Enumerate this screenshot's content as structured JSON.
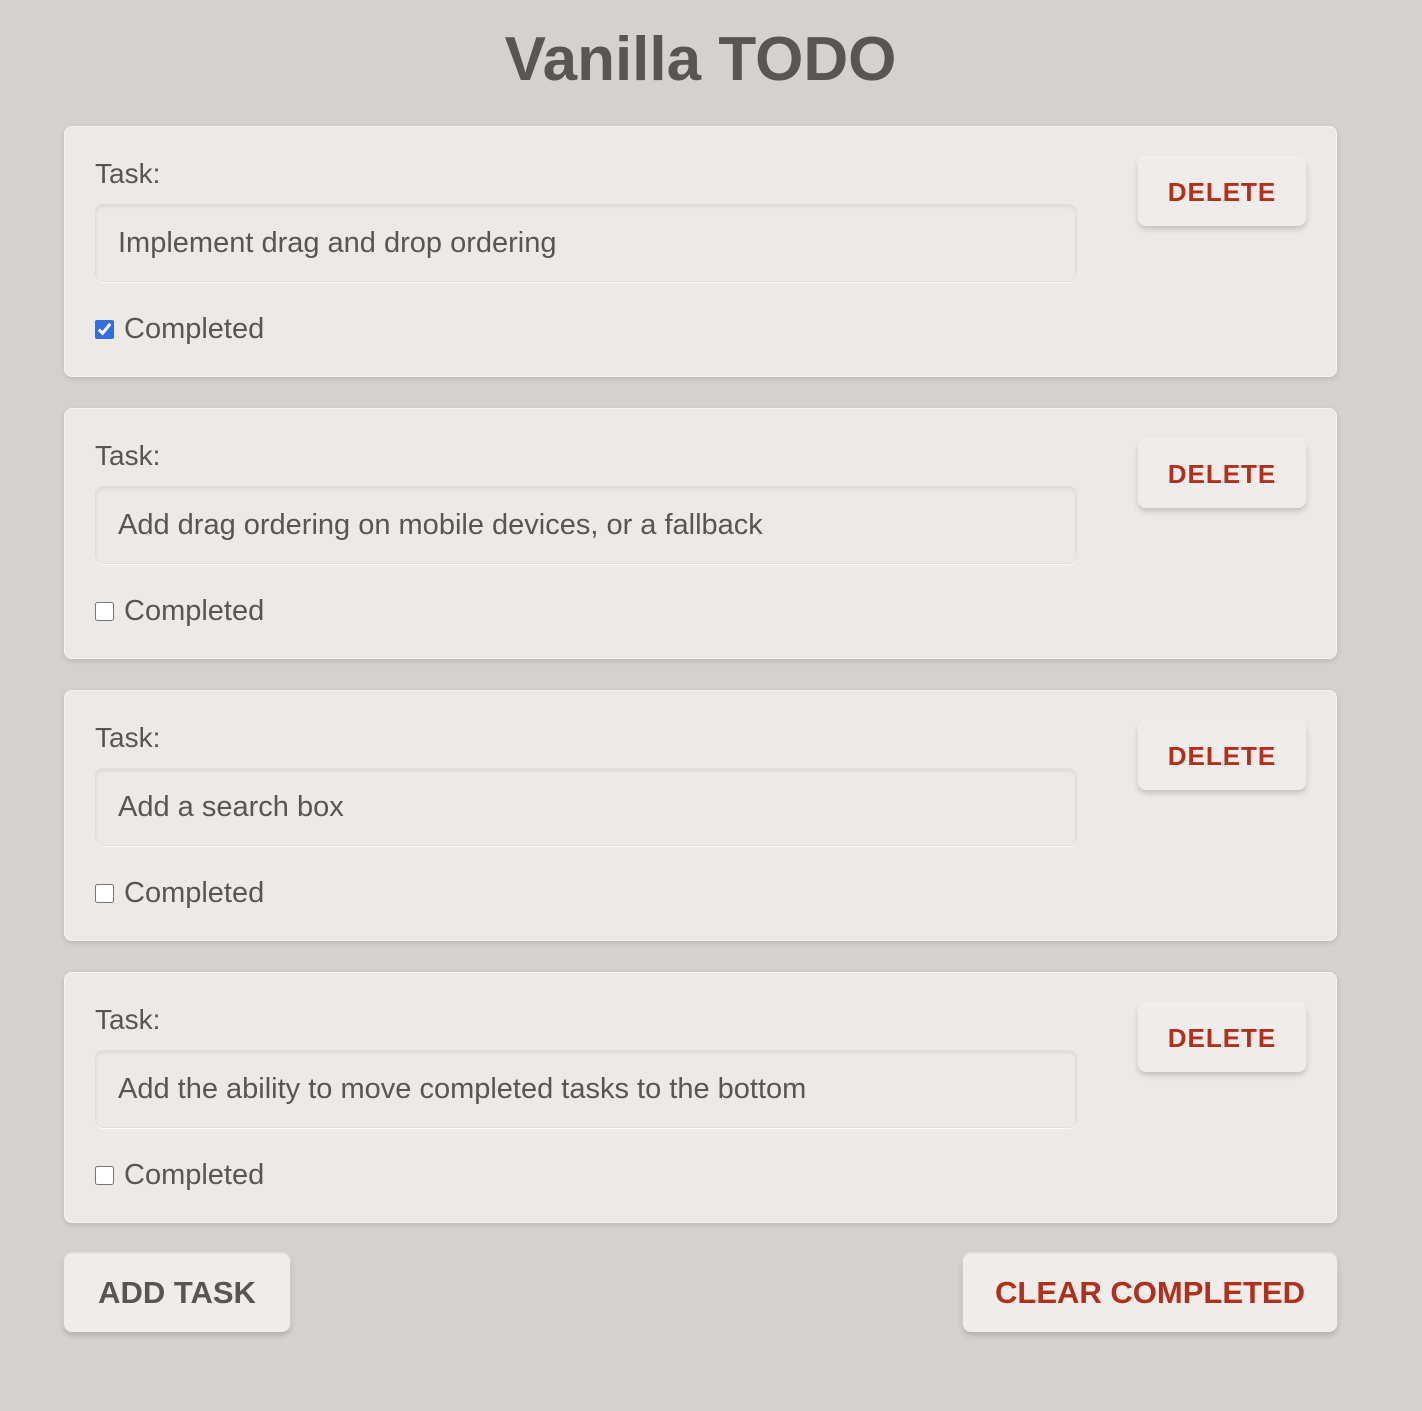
{
  "app": {
    "title": "Vanilla TODO"
  },
  "task_field_label": "Task:",
  "completed_label": "Completed",
  "delete_label": "DELETE",
  "tasks": [
    {
      "text": "Implement drag and drop ordering",
      "completed": true
    },
    {
      "text": "Add drag ordering on mobile devices, or a fallback",
      "completed": false
    },
    {
      "text": "Add a search box",
      "completed": false
    },
    {
      "text": "Add the ability to move completed tasks to the bottom",
      "completed": false
    }
  ],
  "footer": {
    "add_task_label": "ADD TASK",
    "clear_completed_label": "CLEAR COMPLETED"
  },
  "colors": {
    "background": "#d5d1ce",
    "card": "#ede9e6",
    "text": "#575654",
    "danger": "#b0301c",
    "checkbox_accent": "#2f6fe0"
  }
}
